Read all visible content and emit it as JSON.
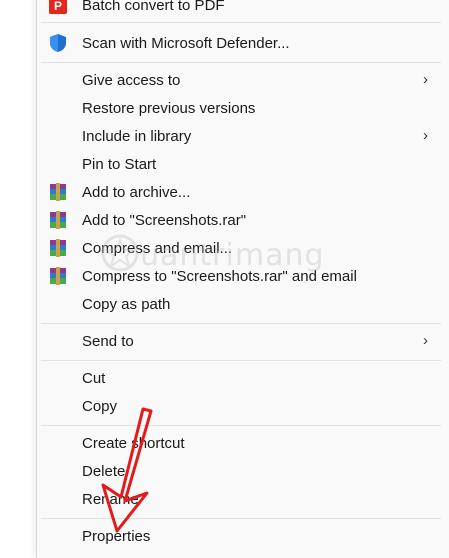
{
  "menu": {
    "items": [
      {
        "label": "Batch convert to PDF",
        "icon": "pdf-convert-icon"
      },
      {
        "label": "Scan with Microsoft Defender...",
        "icon": "defender-shield-icon"
      },
      {
        "label": "Give access to",
        "submenu": true
      },
      {
        "label": "Restore previous versions"
      },
      {
        "label": "Include in library",
        "submenu": true
      },
      {
        "label": "Pin to Start"
      },
      {
        "label": "Add to archive...",
        "icon": "winrar-icon"
      },
      {
        "label": "Add to \"Screenshots.rar\"",
        "icon": "winrar-icon"
      },
      {
        "label": "Compress and email...",
        "icon": "winrar-icon"
      },
      {
        "label": "Compress to \"Screenshots.rar\" and email",
        "icon": "winrar-icon"
      },
      {
        "label": "Copy as path"
      },
      {
        "label": "Send to",
        "submenu": true
      },
      {
        "label": "Cut"
      },
      {
        "label": "Copy"
      },
      {
        "label": "Create shortcut"
      },
      {
        "label": "Delete"
      },
      {
        "label": "Rename"
      },
      {
        "label": "Properties"
      }
    ],
    "chevron": "›"
  },
  "watermark": {
    "text": "uantrimang"
  },
  "colors": {
    "annotation_arrow": "#e21b1b",
    "pdf_icon": "#e2261c",
    "defender_icon": "#1f6fd1"
  }
}
